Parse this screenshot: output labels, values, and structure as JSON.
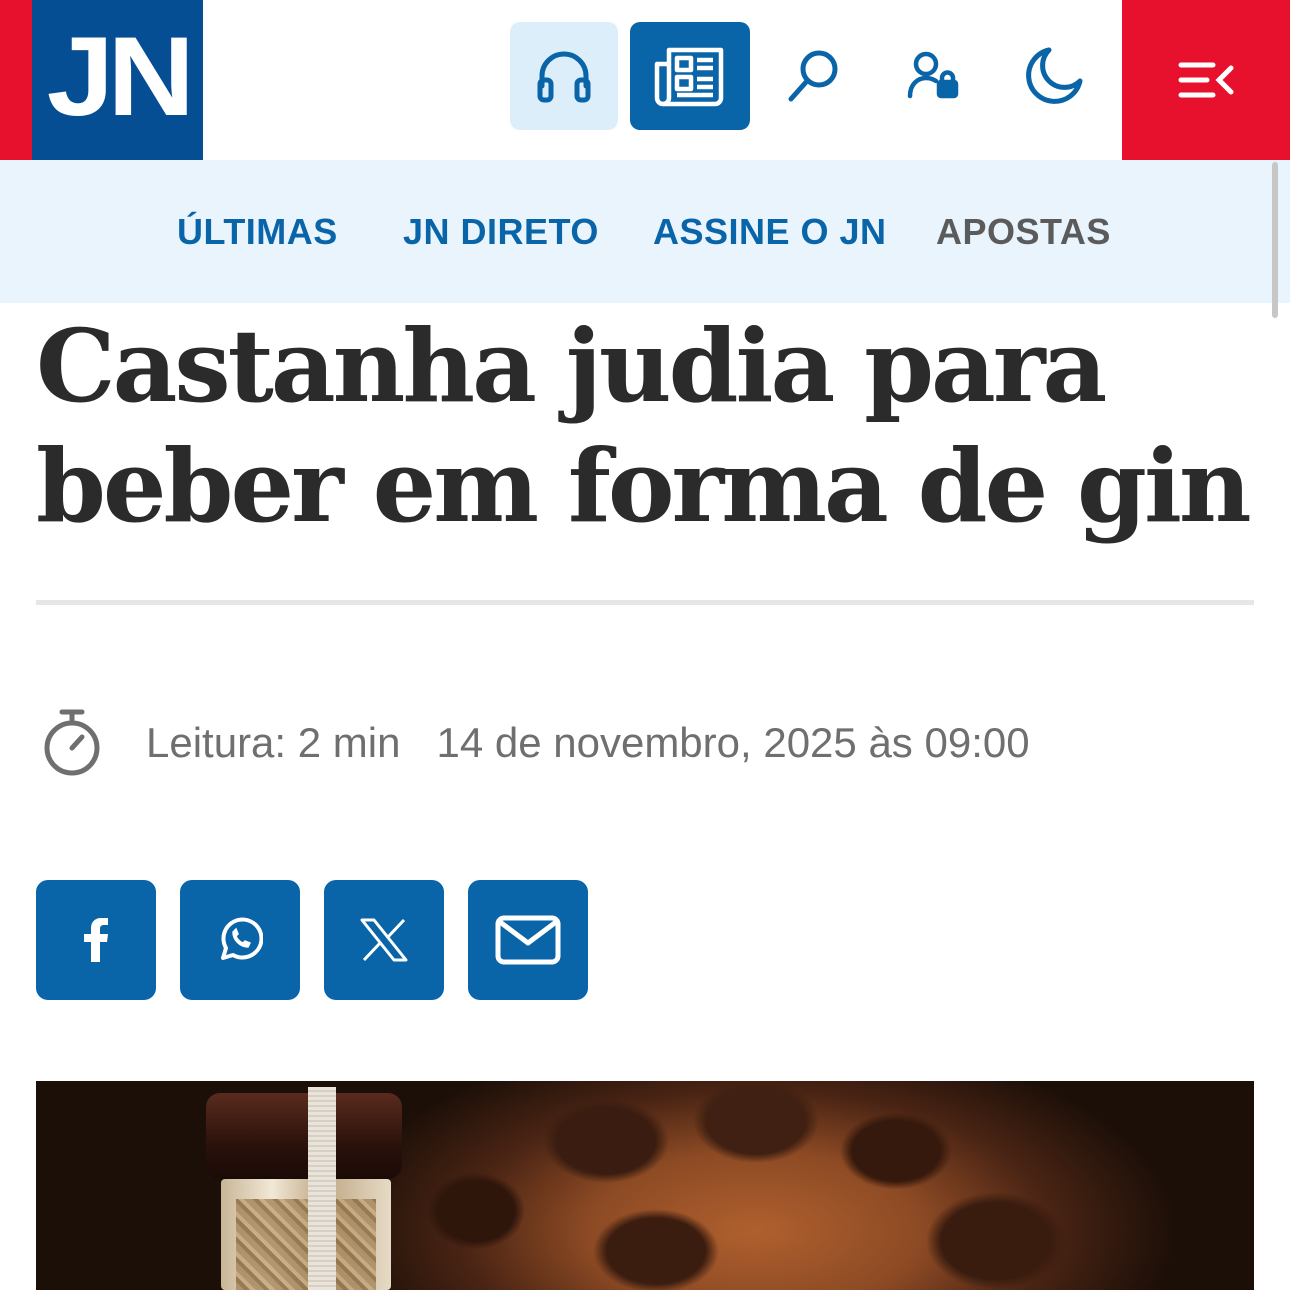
{
  "header": {
    "logo_text": "JN",
    "icons": {
      "audio": "headphones-icon",
      "newspaper": "newspaper-icon",
      "search": "search-icon",
      "account": "user-lock-icon",
      "theme": "moon-icon",
      "menu": "menu-icon"
    },
    "colors": {
      "brand_blue": "#064e94",
      "accent_red": "#e8112d",
      "button_blue": "#0a64a8",
      "light_blue": "#ddeefb"
    }
  },
  "subnav": {
    "items": [
      {
        "label": "ÚLTIMAS"
      },
      {
        "label": "JN DIRETO"
      },
      {
        "label": "ASSINE O JN"
      },
      {
        "label": "APOSTAS"
      }
    ]
  },
  "article": {
    "title": "Castanha judia para beber em forma de gin",
    "reading_time": "Leitura: 2 min",
    "date": "14 de novembro, 2025 às 09:00",
    "clock_icon": "stopwatch-icon"
  },
  "share": {
    "buttons": [
      {
        "icon": "facebook-icon"
      },
      {
        "icon": "whatsapp-icon"
      },
      {
        "icon": "x-icon"
      },
      {
        "icon": "email-icon"
      }
    ]
  }
}
